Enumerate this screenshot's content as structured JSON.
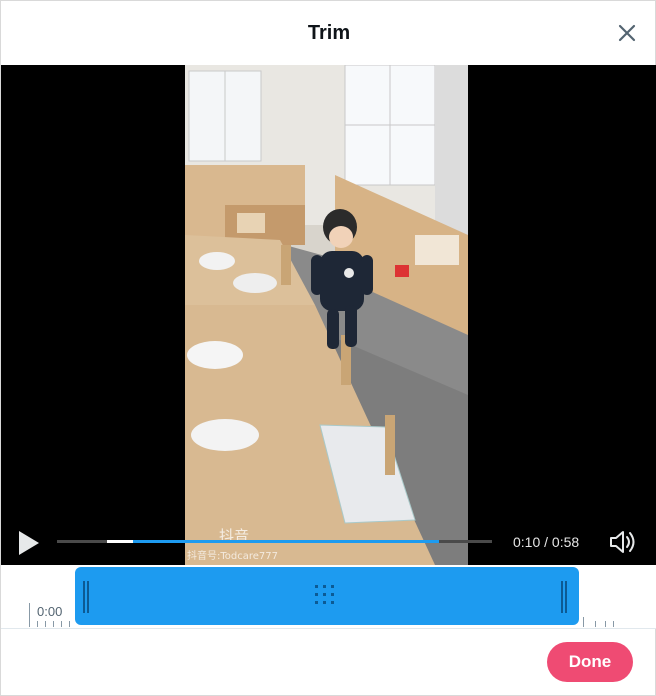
{
  "dialog": {
    "title": "Trim",
    "close_icon": "close-icon"
  },
  "video": {
    "watermark": "抖音",
    "watermark_id": "抖音号:Todcare777",
    "scene": "toddler-walking-in-classroom"
  },
  "player": {
    "play_icon": "play-icon",
    "timecode": "0:10 / 0:58",
    "volume_icon": "volume-icon",
    "progress_played_fraction": 0.17,
    "accent_color": "#1d9bf0"
  },
  "timeline": {
    "start_label": "0:00",
    "selection_color": "#1d9bf0"
  },
  "footer": {
    "done_label": "Done",
    "done_color": "#ef4b73"
  }
}
